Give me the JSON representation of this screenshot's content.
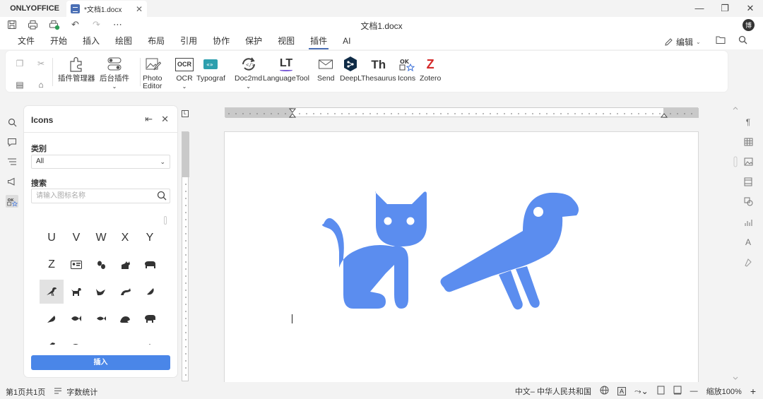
{
  "app": {
    "brand": "ONLYOFFICE",
    "tab_title": "*文档1.docx",
    "doc_title": "文档1.docx",
    "user_initial": "博"
  },
  "menu": {
    "tabs": [
      "文件",
      "开始",
      "插入",
      "绘图",
      "布局",
      "引用",
      "协作",
      "保护",
      "视图",
      "插件",
      "AI"
    ],
    "active": "插件",
    "edit_mode": "编辑"
  },
  "toolbar": {
    "plugin_manager": "插件管理器",
    "background_plugins": "后台插件",
    "photo_editor_1": "Photo",
    "photo_editor_2": "Editor",
    "ocr": "OCR",
    "typograf": "Typograf",
    "doc2md": "Doc2md",
    "languagetool": "LanguageTool",
    "send": "Send",
    "deepl": "DeepL",
    "thesaurus": "Thesaurus",
    "icons": "Icons",
    "zotero": "Zotero",
    "ocr_badge": "OCR",
    "lt_badge": "LT",
    "th_badge": "Th",
    "z_badge": "Z"
  },
  "panel": {
    "title": "Icons",
    "category_label": "类别",
    "category_value": "All",
    "search_label": "搜索",
    "search_placeholder": "请输入图标名称",
    "insert_button": "插入",
    "letters": [
      "U",
      "V",
      "W",
      "X",
      "Y",
      "Z"
    ]
  },
  "status": {
    "page_info": "第1页共1页",
    "word_count": "字数统计",
    "language": "中文– 中华人民共和国",
    "zoom": "缩放100%"
  },
  "colors": {
    "accent": "#4a6fb5",
    "insert_button": "#4a86e8",
    "art": "#5b8def"
  }
}
